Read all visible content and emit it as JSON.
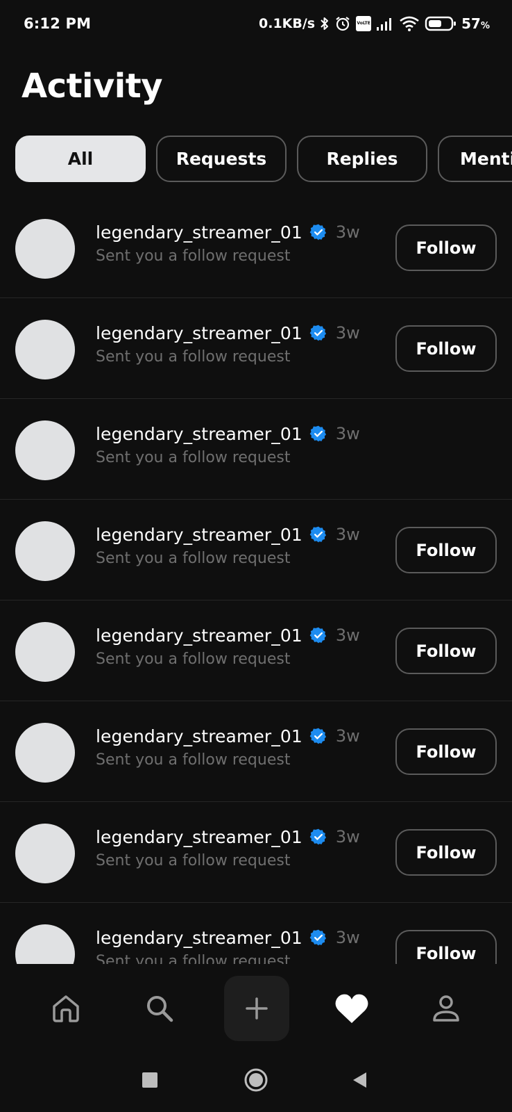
{
  "status_bar": {
    "time": "6:12 PM",
    "network_speed": "0.1KB/s",
    "network_badge": "VoLTE",
    "battery_percent": "57",
    "battery_unit": "%",
    "icons": [
      "bluetooth-icon",
      "alarm-icon",
      "volte-icon",
      "signal-icon",
      "wifi-icon",
      "battery-icon"
    ]
  },
  "page": {
    "title": "Activity"
  },
  "filters": {
    "selected": "All",
    "items": [
      {
        "label": "All"
      },
      {
        "label": "Requests"
      },
      {
        "label": "Replies"
      },
      {
        "label": "Menti"
      }
    ]
  },
  "activity": {
    "items": [
      {
        "username": "legendary_streamer_01",
        "verified": true,
        "time": "3w",
        "subtitle": "Sent you a follow request",
        "action": "Follow"
      },
      {
        "username": "legendary_streamer_01",
        "verified": true,
        "time": "3w",
        "subtitle": "Sent you a follow request",
        "action": "Follow"
      },
      {
        "username": "legendary_streamer_01",
        "verified": true,
        "time": "3w",
        "subtitle": "Sent you a follow request",
        "action": ""
      },
      {
        "username": "legendary_streamer_01",
        "verified": true,
        "time": "3w",
        "subtitle": "Sent you a follow request",
        "action": "Follow"
      },
      {
        "username": "legendary_streamer_01",
        "verified": true,
        "time": "3w",
        "subtitle": "Sent you a follow request",
        "action": "Follow"
      },
      {
        "username": "legendary_streamer_01",
        "verified": true,
        "time": "3w",
        "subtitle": "Sent you a follow request",
        "action": "Follow"
      },
      {
        "username": "legendary_streamer_01",
        "verified": true,
        "time": "3w",
        "subtitle": "Sent you a follow request",
        "action": "Follow"
      },
      {
        "username": "legendary_streamer_01",
        "verified": true,
        "time": "3w",
        "subtitle": "Sent you a follow request",
        "action": "Follow"
      }
    ]
  },
  "bottom_nav": {
    "active": "activity",
    "items": [
      "home-icon",
      "search-icon",
      "plus-icon",
      "heart-icon",
      "person-icon"
    ]
  },
  "colors": {
    "background": "#0f0f0f",
    "chip_active": "#e5e6e8",
    "border": "#5b5b5b",
    "muted_text": "#6f6f6f",
    "verified_blue": "#1d8cf0",
    "avatar": "#e0e1e3"
  }
}
